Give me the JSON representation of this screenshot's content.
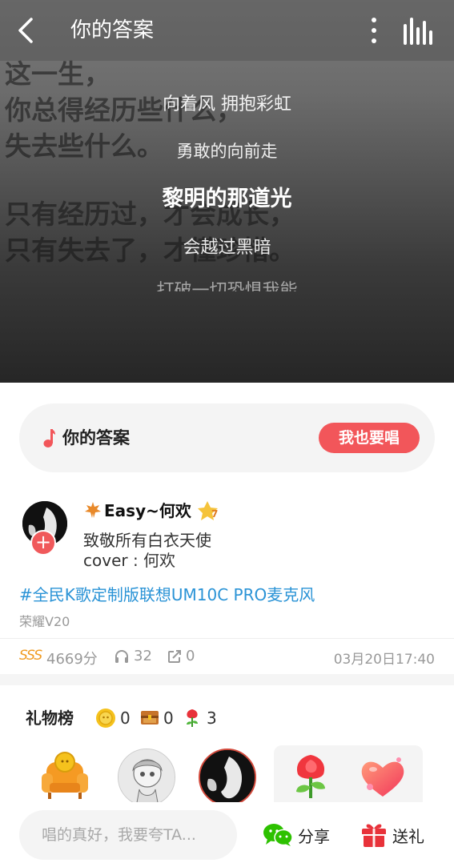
{
  "header": {
    "title": "你的答案"
  },
  "background_text": [
    "这一生，",
    "你总得经历些什么，",
    "失去些什么。",
    "只有经历过，才会成长，",
    "只有失去了，才懂珍惜。"
  ],
  "lyrics": {
    "line1": "向着风 拥抱彩虹",
    "line2": "勇敢的向前走",
    "current": "黎明的那道光",
    "line4": "会越过黑暗",
    "line5": "打破一切恐惧我能"
  },
  "song_card": {
    "name": "你的答案",
    "sing_label": "我也要唱"
  },
  "post": {
    "username": "Easy~何欢",
    "desc1": "致敬所有白衣天使",
    "desc2": "cover : 何欢",
    "hashtag": "#全民K歌定制版联想UM10C PRO麦克风",
    "device": "荣耀V20",
    "follow_symbol": "+"
  },
  "stats": {
    "grade": "SSS",
    "score": "4669分",
    "listens": "32",
    "shares": "0",
    "date": "03月20日17:40"
  },
  "gifts": {
    "title": "礼物榜",
    "coin_count": "0",
    "chest_count": "0",
    "flower_count": "3"
  },
  "bottom_bar": {
    "comment_placeholder": "唱的真好，我要夸TA...",
    "share_label": "分享",
    "gift_label": "送礼"
  },
  "colors": {
    "accent_red": "#f2565a",
    "link_blue": "#2a93d6",
    "sss_orange": "#f09b21",
    "wechat_green": "#2dc100"
  },
  "icons": [
    "back-arrow-icon",
    "more-vertical-icon",
    "equalizer-icon",
    "music-note-icon",
    "leaf-icon",
    "vip-badge-icon",
    "headphone-icon",
    "share-out-icon",
    "coin-icon",
    "treasure-chest-icon",
    "flower-icon",
    "sofa-icon",
    "rose-gift-icon",
    "heart-gift-icon",
    "wechat-icon",
    "gift-box-icon"
  ]
}
